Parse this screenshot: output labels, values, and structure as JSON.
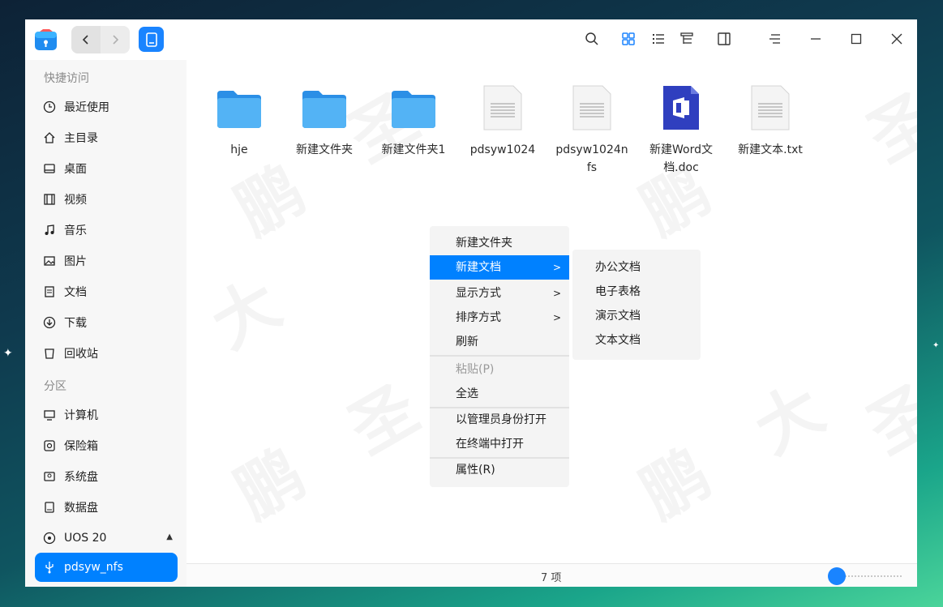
{
  "toolbar": {
    "back_icon": "chevron-left-icon",
    "forward_icon": "chevron-right-icon",
    "location_icon": "tablet-icon",
    "search_icon": "search-icon",
    "icon_view_icon": "grid-icon",
    "list_view_icon": "list-icon",
    "tree_view_icon": "tree-icon",
    "detail_pane_icon": "panel-icon",
    "menu_icon": "hamburger-icon",
    "minimize_icon": "minimize-icon",
    "maximize_icon": "maximize-icon",
    "close_icon": "close-icon"
  },
  "sidebar": {
    "quick_access_header": "快捷访问",
    "partition_header": "分区",
    "quick_items": [
      {
        "label": "最近使用",
        "icon": "clock-icon"
      },
      {
        "label": "主目录",
        "icon": "home-icon"
      },
      {
        "label": "桌面",
        "icon": "desktop-icon"
      },
      {
        "label": "视频",
        "icon": "film-icon"
      },
      {
        "label": "音乐",
        "icon": "music-icon"
      },
      {
        "label": "图片",
        "icon": "image-icon"
      },
      {
        "label": "文档",
        "icon": "document-icon"
      },
      {
        "label": "下载",
        "icon": "download-icon"
      },
      {
        "label": "回收站",
        "icon": "trash-icon"
      }
    ],
    "partition_items": [
      {
        "label": "计算机",
        "icon": "computer-icon"
      },
      {
        "label": "保险箱",
        "icon": "safe-icon"
      },
      {
        "label": "系统盘",
        "icon": "disk-icon"
      },
      {
        "label": "数据盘",
        "icon": "disk-icon"
      },
      {
        "label": "UOS 20",
        "icon": "cdrom-icon"
      },
      {
        "label": "pdsyw_nfs",
        "icon": "usb-icon"
      }
    ],
    "active_item": "pdsyw_nfs"
  },
  "files": [
    {
      "name": "hje",
      "type": "folder"
    },
    {
      "name": "新建文件夹",
      "type": "folder"
    },
    {
      "name": "新建文件夹1",
      "type": "folder"
    },
    {
      "name": "pdsyw1024",
      "type": "text"
    },
    {
      "name": "pdsyw1024nfs",
      "type": "text"
    },
    {
      "name": "新建Word文档.doc",
      "type": "word"
    },
    {
      "name": "新建文本.txt",
      "type": "text"
    }
  ],
  "context_menu": {
    "items": [
      "新建文件夹",
      "新建文档",
      "显示方式",
      "排序方式",
      "刷新",
      "粘贴(P)",
      "全选",
      "以管理员身份打开",
      "在终端中打开",
      "属性(R)"
    ],
    "selected": "新建文档",
    "disabled": [
      "粘贴(P)"
    ]
  },
  "submenu": {
    "items": [
      "办公文档",
      "电子表格",
      "演示文档",
      "文本文档"
    ]
  },
  "status": {
    "item_count": "7 项"
  },
  "colors": {
    "accent": "#0081ff",
    "folder": "#3aa0f0"
  }
}
